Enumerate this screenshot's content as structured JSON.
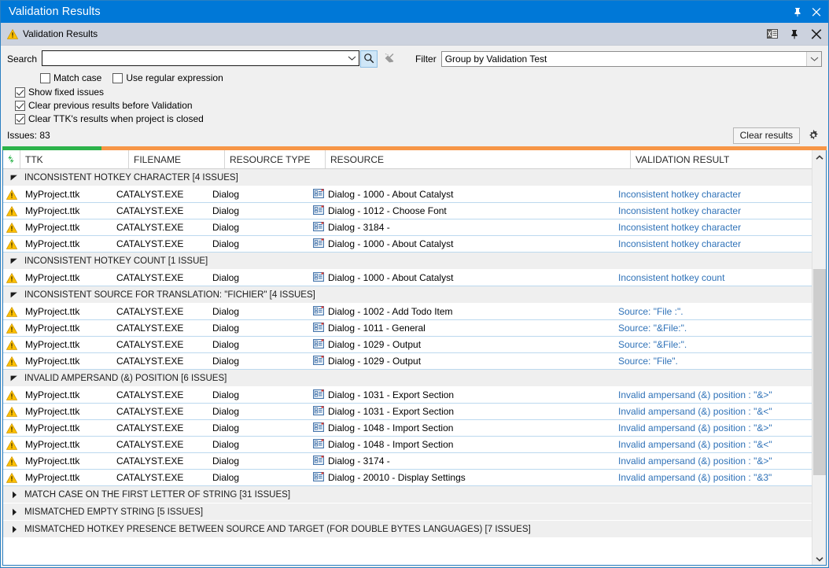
{
  "window": {
    "title": "Validation Results",
    "pin_icon": "pin-icon",
    "close_icon": "close-icon"
  },
  "panel": {
    "title": "Validation Results",
    "warning_icon": "warning-icon",
    "export_icon": "export-excel-icon",
    "pin_icon": "pin-icon",
    "close_icon": "close-icon"
  },
  "toolbar": {
    "search_label": "Search",
    "search_value": "",
    "search_placeholder": "",
    "search_dropdown_icon": "chevron-down-icon",
    "search_button_icon": "search-icon",
    "clear_search_icon": "close-icon",
    "filter_label": "Filter",
    "filter_value": "Group by Validation Test",
    "filter_dropdown_icon": "chevron-down-icon",
    "checkboxes": [
      {
        "label": "Match case",
        "checked": false
      },
      {
        "label": "Use regular expression",
        "checked": false
      },
      {
        "label": "Show fixed issues",
        "checked": true
      },
      {
        "label": "Clear previous results before Validation",
        "checked": true
      },
      {
        "label": "Clear TTK's results when project is closed",
        "checked": true
      }
    ],
    "issues_text": "Issues: 83",
    "clear_results_label": "Clear results",
    "settings_icon": "gear-icon"
  },
  "progress": {
    "percent": 12,
    "fill_color": "#2cb34a",
    "track_color": "#f79646"
  },
  "grid": {
    "sync_icon": "sync-icon",
    "columns": [
      "TTK",
      "FILENAME",
      "RESOURCE TYPE",
      "RESOURCE",
      "VALIDATION RESULT"
    ],
    "groups": [
      {
        "label": "INCONSISTENT HOTKEY CHARACTER  [4 ISSUES]",
        "expanded": true,
        "rows": [
          {
            "icon": "warning-icon",
            "ttk": "MyProject.ttk",
            "filename": "CATALYST.EXE",
            "resource_type": "Dialog",
            "resource_icon": "dialog-icon",
            "resource": "Dialog - 1000 - About Catalyst",
            "validation_result": "Inconsistent hotkey character"
          },
          {
            "icon": "warning-icon",
            "ttk": "MyProject.ttk",
            "filename": "CATALYST.EXE",
            "resource_type": "Dialog",
            "resource_icon": "dialog-icon",
            "resource": "Dialog - 1012 - Choose Font",
            "validation_result": "Inconsistent hotkey character"
          },
          {
            "icon": "warning-icon",
            "ttk": "MyProject.ttk",
            "filename": "CATALYST.EXE",
            "resource_type": "Dialog",
            "resource_icon": "dialog-icon",
            "resource": "Dialog - 3184 - ",
            "validation_result": "Inconsistent hotkey character"
          },
          {
            "icon": "warning-icon",
            "ttk": "MyProject.ttk",
            "filename": "CATALYST.EXE",
            "resource_type": "Dialog",
            "resource_icon": "dialog-icon",
            "resource": "Dialog - 1000 - About Catalyst",
            "validation_result": "Inconsistent hotkey character"
          }
        ]
      },
      {
        "label": "INCONSISTENT HOTKEY COUNT  [1 ISSUE]",
        "expanded": true,
        "rows": [
          {
            "icon": "warning-icon",
            "ttk": "MyProject.ttk",
            "filename": "CATALYST.EXE",
            "resource_type": "Dialog",
            "resource_icon": "dialog-icon",
            "resource": "Dialog - 1000 - About Catalyst",
            "validation_result": "Inconsistent hotkey count"
          }
        ]
      },
      {
        "label": "INCONSISTENT SOURCE FOR TRANSLATION: \"FICHIER\" [4 ISSUES]",
        "expanded": true,
        "rows": [
          {
            "icon": "warning-icon",
            "ttk": "MyProject.ttk",
            "filename": "CATALYST.EXE",
            "resource_type": "Dialog",
            "resource_icon": "dialog-icon",
            "resource": "Dialog - 1002 - Add Todo Item",
            "validation_result": "Source: \"File :\"."
          },
          {
            "icon": "warning-icon",
            "ttk": "MyProject.ttk",
            "filename": "CATALYST.EXE",
            "resource_type": "Dialog",
            "resource_icon": "dialog-icon",
            "resource": "Dialog - 1011 - General",
            "validation_result": "Source: \"&File:\"."
          },
          {
            "icon": "warning-icon",
            "ttk": "MyProject.ttk",
            "filename": "CATALYST.EXE",
            "resource_type": "Dialog",
            "resource_icon": "dialog-icon",
            "resource": "Dialog - 1029 - Output",
            "validation_result": "Source: \"&File:\"."
          },
          {
            "icon": "warning-icon",
            "ttk": "MyProject.ttk",
            "filename": "CATALYST.EXE",
            "resource_type": "Dialog",
            "resource_icon": "dialog-icon",
            "resource": "Dialog - 1029 - Output",
            "validation_result": "Source: \"File\"."
          }
        ]
      },
      {
        "label": "INVALID AMPERSAND (&) POSITION  [6 ISSUES]",
        "expanded": true,
        "rows": [
          {
            "icon": "warning-icon",
            "ttk": "MyProject.ttk",
            "filename": "CATALYST.EXE",
            "resource_type": "Dialog",
            "resource_icon": "dialog-icon",
            "resource": "Dialog - 1031 - Export Section",
            "validation_result": "Invalid ampersand (&) position : \"&>\""
          },
          {
            "icon": "warning-icon",
            "ttk": "MyProject.ttk",
            "filename": "CATALYST.EXE",
            "resource_type": "Dialog",
            "resource_icon": "dialog-icon",
            "resource": "Dialog - 1031 - Export Section",
            "validation_result": "Invalid ampersand (&) position : \"&<\""
          },
          {
            "icon": "warning-icon",
            "ttk": "MyProject.ttk",
            "filename": "CATALYST.EXE",
            "resource_type": "Dialog",
            "resource_icon": "dialog-icon",
            "resource": "Dialog - 1048 - Import Section",
            "validation_result": "Invalid ampersand (&) position : \"&>\""
          },
          {
            "icon": "warning-icon",
            "ttk": "MyProject.ttk",
            "filename": "CATALYST.EXE",
            "resource_type": "Dialog",
            "resource_icon": "dialog-icon",
            "resource": "Dialog - 1048 - Import Section",
            "validation_result": "Invalid ampersand (&) position : \"&<\""
          },
          {
            "icon": "warning-icon",
            "ttk": "MyProject.ttk",
            "filename": "CATALYST.EXE",
            "resource_type": "Dialog",
            "resource_icon": "dialog-icon",
            "resource": "Dialog - 3174 - ",
            "validation_result": "Invalid ampersand (&) position : \"&>\""
          },
          {
            "icon": "warning-icon",
            "ttk": "MyProject.ttk",
            "filename": "CATALYST.EXE",
            "resource_type": "Dialog",
            "resource_icon": "dialog-icon",
            "resource": "Dialog - 20010 - Display Settings",
            "validation_result": "Invalid ampersand (&) position : \"&3\""
          }
        ]
      },
      {
        "label": "MATCH CASE ON THE FIRST LETTER OF STRING [31 ISSUES]",
        "expanded": false,
        "rows": []
      },
      {
        "label": "MISMATCHED EMPTY STRING  [5 ISSUES]",
        "expanded": false,
        "rows": []
      },
      {
        "label": "MISMATCHED HOTKEY PRESENCE BETWEEN SOURCE AND TARGET (FOR DOUBLE BYTES LANGUAGES) [7 ISSUES]",
        "expanded": false,
        "rows": []
      }
    ]
  },
  "scrollbar": {
    "up_icon": "chevron-up-icon",
    "down_icon": "chevron-down-icon"
  },
  "colors": {
    "title_bar": "#0078d7",
    "panel_header": "#ccd2de",
    "link": "#2f72b8",
    "warning": "#ffc000"
  }
}
